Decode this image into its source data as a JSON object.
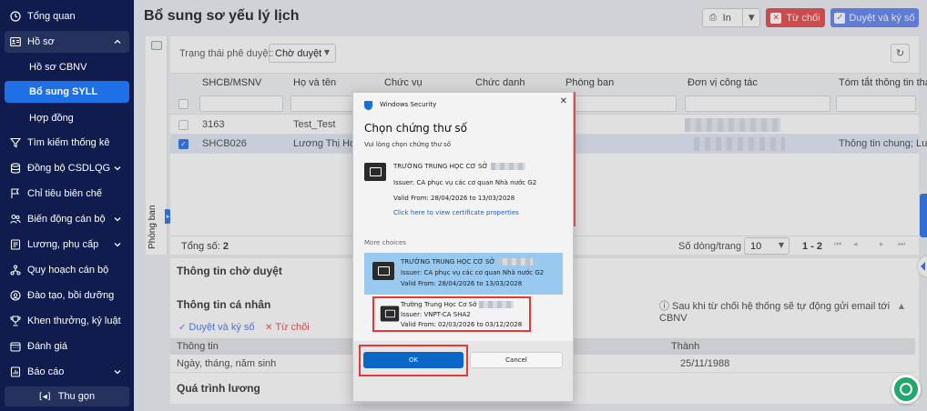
{
  "sidebar": {
    "items": [
      {
        "label": "Tổng quan",
        "icon": "clock-icon"
      },
      {
        "label": "Hồ sơ",
        "icon": "id-card-icon"
      },
      {
        "label": "Hồ sơ CBNV"
      },
      {
        "label": "Bổ sung SYLL"
      },
      {
        "label": "Hợp đồng"
      },
      {
        "label": "Tìm kiếm thống kê",
        "icon": "filter-icon"
      },
      {
        "label": "Đồng bộ CSDLQG",
        "icon": "database-icon"
      },
      {
        "label": "Chỉ tiêu biên chế",
        "icon": "flag-icon"
      },
      {
        "label": "Biến động cán bộ",
        "icon": "users-icon"
      },
      {
        "label": "Lương, phụ cấp",
        "icon": "document-icon"
      },
      {
        "label": "Quy hoạch cán bộ",
        "icon": "network-icon"
      },
      {
        "label": "Đào tạo, bồi dưỡng",
        "icon": "award-icon"
      },
      {
        "label": "Khen thưởng, kỷ luật",
        "icon": "trophy-icon"
      },
      {
        "label": "Đánh giá",
        "icon": "calendar-icon"
      },
      {
        "label": "Báo cáo",
        "icon": "report-icon"
      }
    ],
    "collapse_label": "Thu gọn",
    "accent": "#1f6fe6",
    "background": "#0f1c4d"
  },
  "header": {
    "title": "Bổ sung sơ yếu lý lịch",
    "print_label": "In",
    "reject_label": "Từ chối",
    "approve_label": "Duyệt và ký số"
  },
  "filter_strip": {
    "label": "Phòng ban"
  },
  "filters": {
    "status_label": "Trạng thái phê duyệt:",
    "status_value": "Chờ duyệt"
  },
  "table": {
    "columns": [
      "SHCB/MSNV",
      "Họ và tên",
      "Chức vụ",
      "Chức danh",
      "Phòng ban",
      "Đơn vị công tác",
      "Tóm tắt thông tin tha"
    ],
    "rows": [
      {
        "code": "3163",
        "name": "Test_Test",
        "summary": ""
      },
      {
        "code": "SHCB026",
        "name": "Lương Thị Hoài",
        "summary": "Thông tin chung; Lươ",
        "selected": true
      }
    ],
    "total_label": "Tổng số:",
    "total_value": "2",
    "rows_per_page_label": "Số dòng/trang",
    "rows_per_page": "10",
    "range": "1 - 2"
  },
  "info": {
    "pending_title": "Thông tin chờ duyệt",
    "personal_title": "Thông tin cá nhân",
    "note": "Sau khi từ chối hệ thống sẽ tự động gửi email tới CBNV",
    "approve_label": "Duyệt và ký số",
    "reject_label": "Từ chối",
    "col_info": "Thông tin",
    "col_value": "Thành",
    "row_label": "Ngày, tháng, năm sinh",
    "row_value": "25/11/1988",
    "salary_title": "Quá trình lương"
  },
  "dialog": {
    "app": "Windows Security",
    "title": "Chọn chứng thư số",
    "subtitle": "Vui lòng chọn chứng thư số",
    "selected_cert": {
      "name": "TRƯỜNG TRUNG HỌC CƠ SỞ",
      "issuer": "Issuer: CA phục vụ các cơ quan Nhà nước G2",
      "valid": "Valid From: 28/04/2026 to 13/03/2028",
      "link": "Click here to view certificate properties"
    },
    "more_choices": "More choices",
    "choices": [
      {
        "name": "TRƯỜNG TRUNG HỌC CƠ SỞ",
        "issuer": "Issuer: CA phục vụ các cơ quan Nhà nước G2",
        "valid": "Valid From: 28/04/2026 to 13/03/2028"
      },
      {
        "name": "Trường Trung Học Cơ Sở",
        "issuer": "Issuer: VNPT-CA SHA2",
        "valid": "Valid From: 02/03/2026 to 03/12/2028"
      }
    ],
    "ok_label": "OK",
    "cancel_label": "Cancel"
  }
}
